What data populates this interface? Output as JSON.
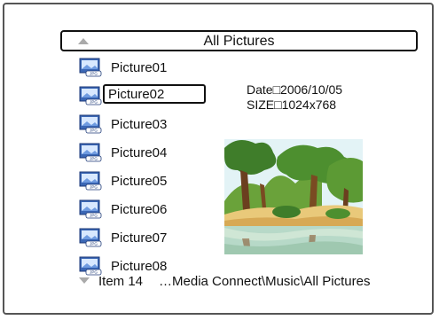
{
  "header": {
    "title": "All Pictures"
  },
  "list": {
    "items": [
      {
        "label": "Picture01"
      },
      {
        "label": "Picture02"
      },
      {
        "label": "Picture03"
      },
      {
        "label": "Picture04"
      },
      {
        "label": "Picture05"
      },
      {
        "label": "Picture06"
      },
      {
        "label": "Picture07"
      },
      {
        "label": "Picture08"
      }
    ],
    "selected_index": 1,
    "icon": "jpg-file-icon"
  },
  "info": {
    "date": "Date□2006/10/05",
    "size": "SIZE□1024x768"
  },
  "preview": {
    "icon": "landscape-thumbnail"
  },
  "footer": {
    "item_count": "Item 14",
    "path": "…Media Connect\\Music\\All Pictures"
  },
  "colors": {
    "border": "#111111",
    "frame": "#555555",
    "arrow": "#aaaaaa"
  }
}
